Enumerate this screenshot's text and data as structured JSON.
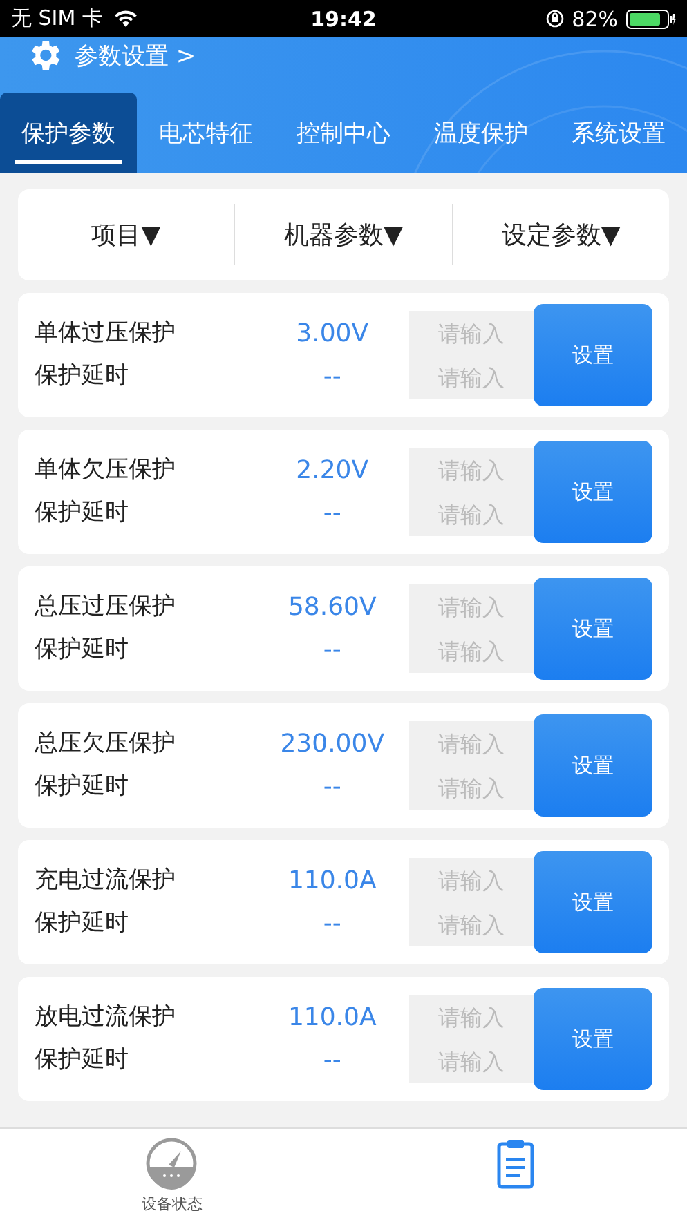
{
  "status_bar": {
    "carrier": "无 SIM 卡",
    "time": "19:42",
    "battery": "82%"
  },
  "header": {
    "title": "参数设置 >"
  },
  "tabs": [
    {
      "label": "保护参数",
      "selected": true
    },
    {
      "label": "电芯特征",
      "selected": false
    },
    {
      "label": "控制中心",
      "selected": false
    },
    {
      "label": "温度保护",
      "selected": false
    },
    {
      "label": "系统设置",
      "selected": false
    }
  ],
  "table_header": [
    "项目▼",
    "机器参数▼",
    "设定参数▼"
  ],
  "rows": [
    {
      "name": "单体过压保护",
      "delay_label": "保护延时",
      "value": "3.00V",
      "delay_value": "--",
      "placeholder": "请输入",
      "delay_placeholder": "请输入",
      "button": "设置"
    },
    {
      "name": "单体欠压保护",
      "delay_label": "保护延时",
      "value": "2.20V",
      "delay_value": "--",
      "placeholder": "请输入",
      "delay_placeholder": "请输入",
      "button": "设置"
    },
    {
      "name": "总压过压保护",
      "delay_label": "保护延时",
      "value": "58.60V",
      "delay_value": "--",
      "placeholder": "请输入",
      "delay_placeholder": "请输入",
      "button": "设置"
    },
    {
      "name": "总压欠压保护",
      "delay_label": "保护延时",
      "value": "230.00V",
      "delay_value": "--",
      "placeholder": "请输入",
      "delay_placeholder": "请输入",
      "button": "设置"
    },
    {
      "name": "充电过流保护",
      "delay_label": "保护延时",
      "value": "110.0A",
      "delay_value": "--",
      "placeholder": "请输入",
      "delay_placeholder": "请输入",
      "button": "设置"
    },
    {
      "name": "放电过流保护",
      "delay_label": "保护延时",
      "value": "110.0A",
      "delay_value": "--",
      "placeholder": "请输入",
      "delay_placeholder": "请输入",
      "button": "设置"
    }
  ],
  "bottom_nav": [
    {
      "kind": "gauge",
      "label": "设备状态",
      "selected": false
    },
    {
      "kind": "clipboard",
      "selected": true
    }
  ]
}
